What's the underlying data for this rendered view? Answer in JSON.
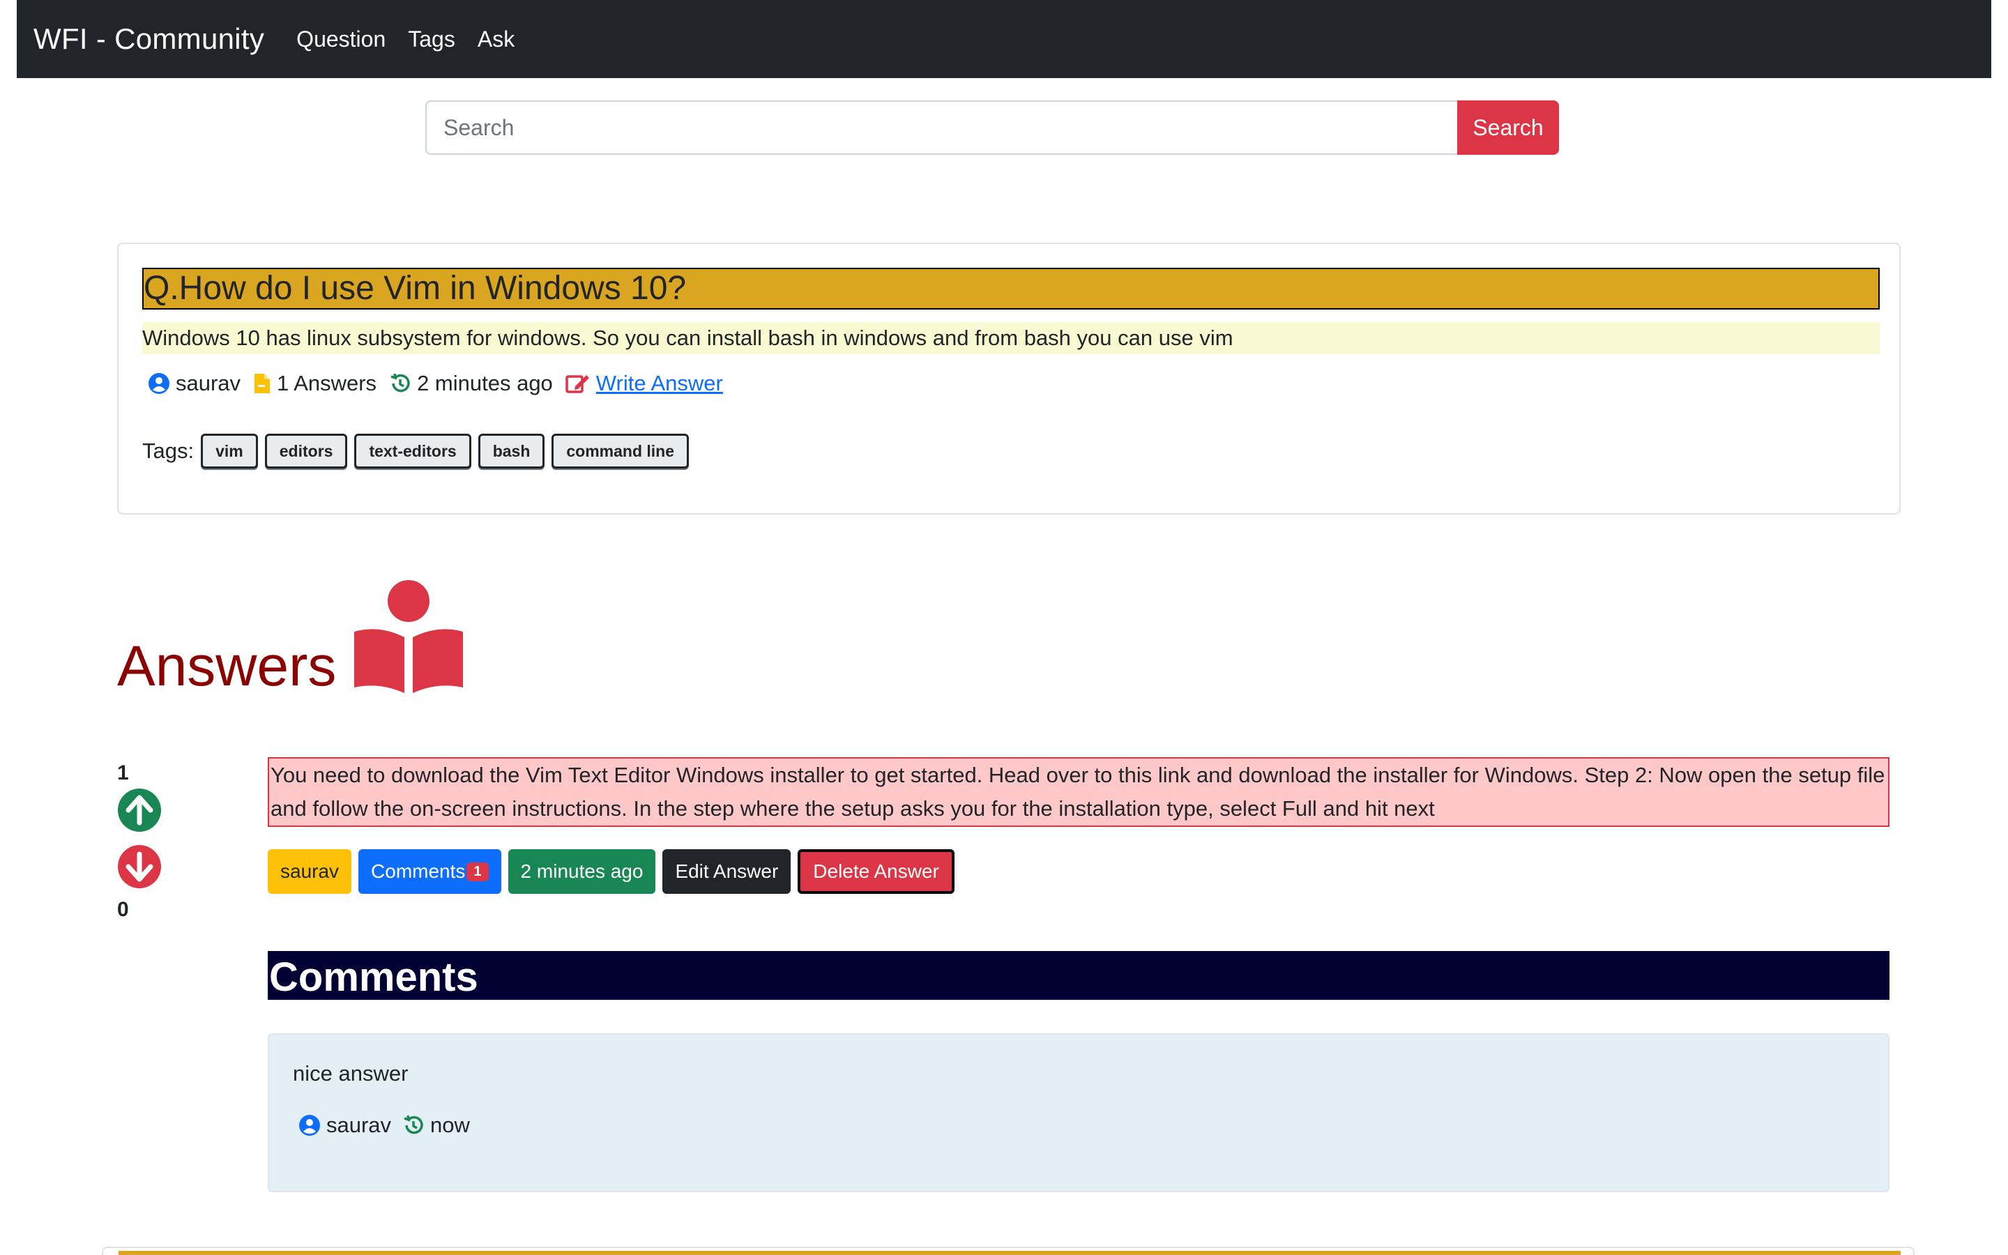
{
  "navbar": {
    "brand": "WFI - Community",
    "links": [
      "Question",
      "Tags",
      "Ask"
    ]
  },
  "search": {
    "placeholder": "Search",
    "value": "",
    "button_label": "Search"
  },
  "question": {
    "title": "Q.How do I use Vim in Windows 10?",
    "body": "Windows 10 has linux subsystem for windows. So you can install bash in windows and from bash you can use vim",
    "author": "saurav",
    "answers_count": "1 Answers",
    "time": "2 minutes ago",
    "write_answer_label": "Write Answer",
    "tags_label": "Tags:",
    "tags": [
      "vim",
      "editors",
      "text-editors",
      "bash",
      "command line"
    ]
  },
  "answers_section": {
    "title": "Answers"
  },
  "answer": {
    "upvotes": "1",
    "downvotes": "0",
    "body": "You need to download the Vim Text Editor Windows installer to get started. Head over to this link and download the installer for Windows. Step 2: Now open the setup file and follow the on-screen instructions. In the step where the setup asks you for the installation type, select Full and hit next",
    "author": "saurav",
    "comments_label": "Comments",
    "comments_count": "1",
    "time": "2 minutes ago",
    "edit_label": "Edit Answer",
    "delete_label": "Delete Answer"
  },
  "comments_section": {
    "title": "Comments",
    "comments": [
      {
        "text": "nice answer",
        "author": "saurav",
        "time": "now"
      }
    ]
  },
  "colors": {
    "navbar_bg": "#212529",
    "danger": "#dc3545",
    "question_title_bg": "#daa520",
    "question_body_bg": "#fafad2",
    "answers_title": "#8b0000",
    "answer_bg": "#ffc8c8",
    "comments_head_bg": "#000033",
    "comment_card_bg": "#e3eff5",
    "upvote": "#198754",
    "downvote": "#dc3545"
  },
  "icons": {
    "author": "user-circle-icon",
    "answers": "file-icon",
    "time": "history-icon",
    "write": "edit-icon",
    "answers_heading": "book-reader-icon",
    "upvote": "arrow-up-circle-icon",
    "downvote": "arrow-down-circle-icon"
  }
}
